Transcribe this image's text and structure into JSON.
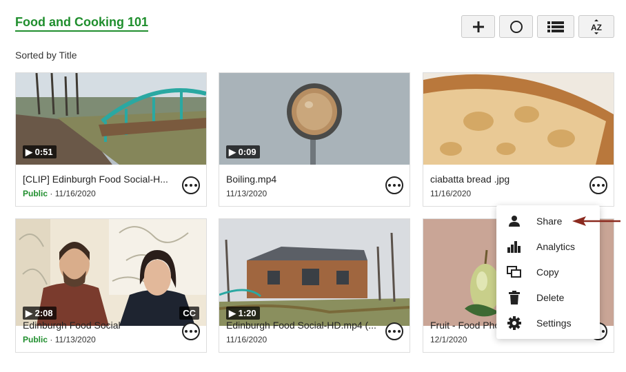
{
  "header": {
    "title": "Food and Cooking 101",
    "sorted_label": "Sorted by Title"
  },
  "toolbar": {
    "buttons": [
      {
        "icon": "plus-icon"
      },
      {
        "icon": "circle-icon"
      },
      {
        "icon": "list-view-icon"
      },
      {
        "icon": "sort-az-icon",
        "text": "AZ"
      }
    ]
  },
  "cards": [
    {
      "name": "[CLIP] Edinburgh Food Social-H...",
      "status": "Public",
      "sep": " · ",
      "date": "11/16/2020",
      "duration": "▶ 0:51"
    },
    {
      "name": "Boiling.mp4",
      "date": "11/13/2020",
      "duration": "▶ 0:09"
    },
    {
      "name": "ciabatta bread .jpg",
      "date": "11/16/2020"
    },
    {
      "name": "Edinburgh Food Social",
      "status": "Public",
      "sep": " · ",
      "date": "11/13/2020",
      "duration": "▶ 2:08",
      "badge": "CC"
    },
    {
      "name": "Edinburgh Food Social-HD.mp4 (...",
      "date": "11/16/2020",
      "duration": "▶ 1:20"
    },
    {
      "name": "Fruit - Food Photography",
      "date": "12/1/2020"
    }
  ],
  "context_menu": {
    "items": [
      {
        "label": "Share",
        "icon": "person-icon"
      },
      {
        "label": "Analytics",
        "icon": "bar-chart-icon"
      },
      {
        "label": "Copy",
        "icon": "copy-icon"
      },
      {
        "label": "Delete",
        "icon": "trash-icon"
      },
      {
        "label": "Settings",
        "icon": "gear-icon"
      }
    ]
  },
  "colors": {
    "accent": "#1f8e2d",
    "annotation_arrow": "#8b2a1f"
  }
}
